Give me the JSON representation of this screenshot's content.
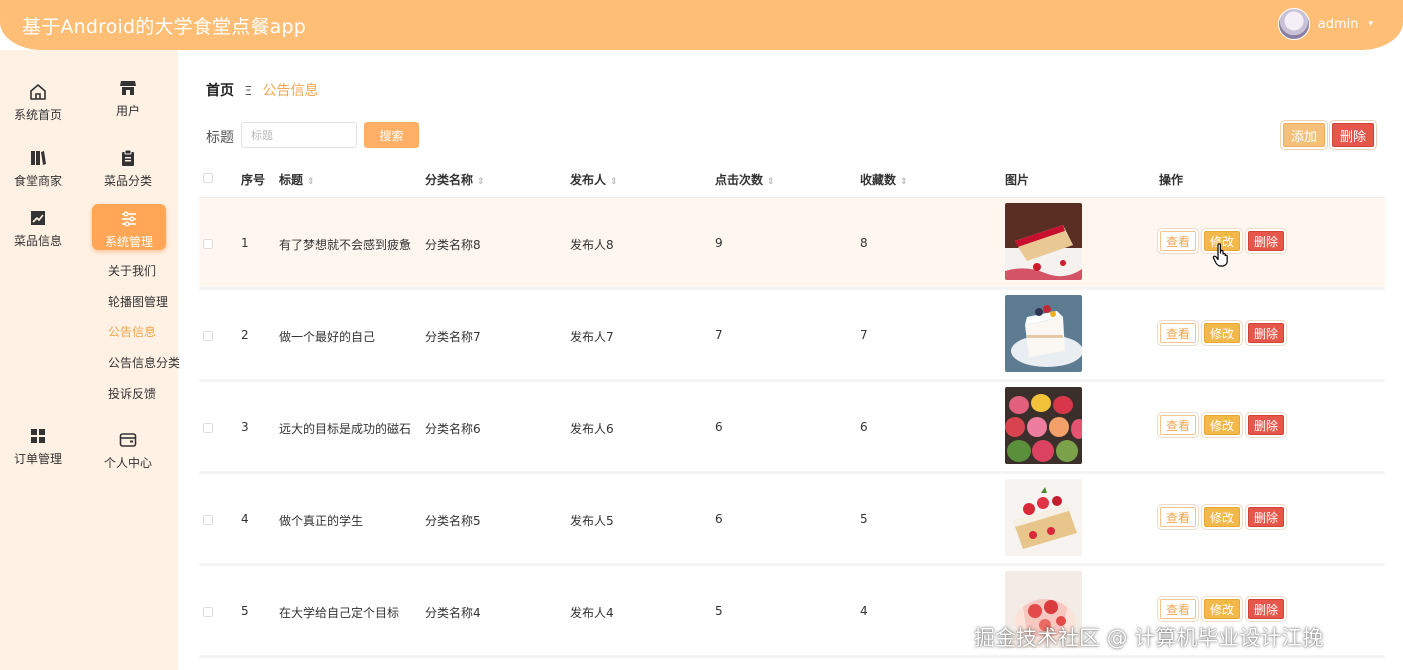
{
  "header": {
    "title": "基于Android的大学食堂点餐app",
    "username": "admin",
    "caret": "▾"
  },
  "sidebar": {
    "items": [
      {
        "label": "系统首页",
        "icon": "home-icon"
      },
      {
        "label": "用户",
        "icon": "store-icon"
      },
      {
        "label": "食堂商家",
        "icon": "books-icon"
      },
      {
        "label": "菜品分类",
        "icon": "clipboard-icon"
      },
      {
        "label": "菜品信息",
        "icon": "chart-icon"
      },
      {
        "label": "系统管理",
        "icon": "sliders-icon",
        "active": true
      },
      {
        "label": "订单管理",
        "icon": "grid-icon"
      },
      {
        "label": "个人中心",
        "icon": "wallet-icon"
      }
    ],
    "sub_items": [
      "关于我们",
      "轮播图管理",
      "公告信息",
      "公告信息分类",
      "投诉反馈"
    ],
    "active_sub": "公告信息"
  },
  "breadcrumb": {
    "home": "首页",
    "separator": "Ξ",
    "current": "公告信息"
  },
  "search": {
    "label": "标题",
    "placeholder": "标题",
    "button": "搜索"
  },
  "toolbar": {
    "add_label": "添加",
    "delete_label": "删除"
  },
  "table": {
    "headers": {
      "index": "序号",
      "title": "标题",
      "category": "分类名称",
      "publisher": "发布人",
      "clicks": "点击次数",
      "favorites": "收藏数",
      "image": "图片",
      "actions": "操作"
    },
    "sort_icon": "⇕",
    "actions": {
      "view": "查看",
      "edit": "修改",
      "delete": "删除"
    },
    "rows": [
      {
        "index": "1",
        "title": "有了梦想就不会感到疲惫",
        "category": "分类名称8",
        "publisher": "发布人8",
        "clicks": "9",
        "favorites": "8",
        "image": "cake-slice-image"
      },
      {
        "index": "2",
        "title": "做一个最好的自己",
        "category": "分类名称7",
        "publisher": "发布人7",
        "clicks": "7",
        "favorites": "7",
        "image": "cream-cake-image"
      },
      {
        "index": "3",
        "title": "远大的目标是成功的磁石",
        "category": "分类名称6",
        "publisher": "发布人6",
        "clicks": "6",
        "favorites": "6",
        "image": "macarons-image"
      },
      {
        "index": "4",
        "title": "做个真正的学生",
        "category": "分类名称5",
        "publisher": "发布人5",
        "clicks": "6",
        "favorites": "5",
        "image": "strawberry-roll-image"
      },
      {
        "index": "5",
        "title": "在大学给自己定个目标",
        "category": "分类名称4",
        "publisher": "发布人4",
        "clicks": "5",
        "favorites": "4",
        "image": "strawberry-dessert-image"
      }
    ]
  },
  "watermark": "掘金技术社区 @ 计算机毕业设计江挽",
  "colors": {
    "header": "#ffbe75",
    "sidebar": "#fff2e5",
    "accent": "#ffa756",
    "danger": "#e4574a",
    "edit": "#f2b94a"
  }
}
